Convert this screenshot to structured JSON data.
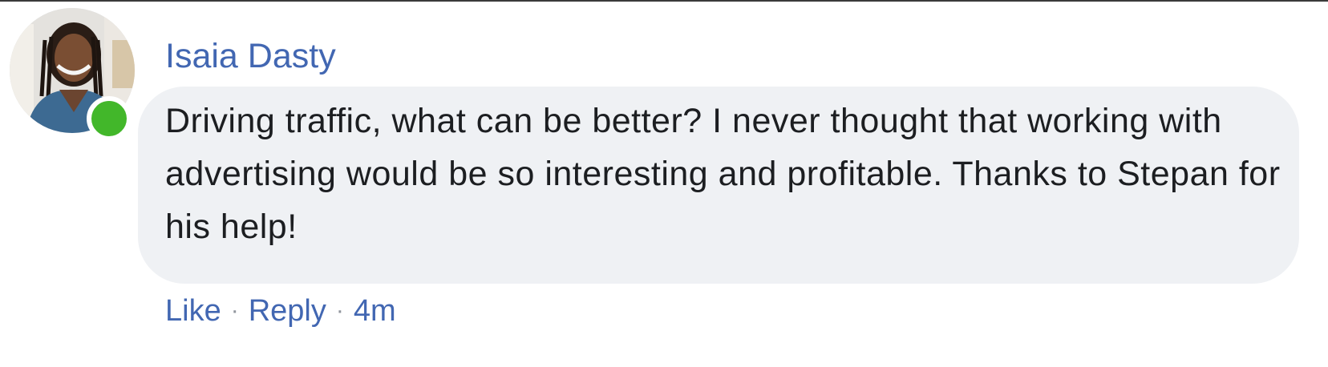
{
  "comment": {
    "author": "Isaia Dasty",
    "text": "Driving traffic, what can be better? I never thought that working with advertising would be so interesting and profitable. Thanks to Stepan for his help!",
    "actions": {
      "like": "Like",
      "reply": "Reply",
      "separator": "·",
      "timestamp": "4m"
    },
    "online_status": "online"
  },
  "colors": {
    "link": "#4267b2",
    "bubble": "#eff1f4",
    "text": "#1c1e21",
    "presence": "#42b72a"
  },
  "icons": {
    "presence": "online-dot-icon",
    "avatar": "user-avatar"
  }
}
